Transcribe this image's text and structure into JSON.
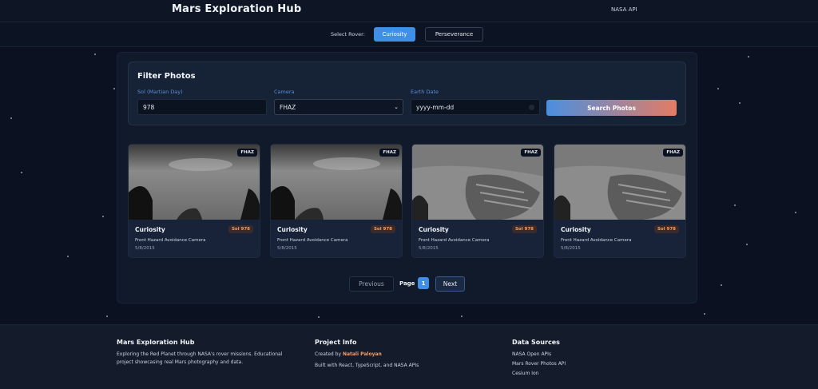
{
  "header": {
    "title": "Mars Exploration Hub",
    "nasa_link": "NASA API"
  },
  "rover_select": {
    "label": "Select Rover:",
    "options": [
      "Curiosity",
      "Perseverance"
    ],
    "selected": "Curiosity"
  },
  "filters": {
    "title": "Filter Photos",
    "sol_label": "Sol (Martian Day)",
    "sol_value": "978",
    "camera_label": "Camera",
    "camera_value": "FHAZ",
    "date_label": "Earth Date",
    "date_placeholder": "yyyy-mm-dd",
    "search_label": "Search Photos"
  },
  "photos": [
    {
      "camera_badge": "FHAZ",
      "rover": "Curiosity",
      "sol": "Sol 978",
      "camera_name": "Front Hazard Avoidance Camera",
      "date": "5/8/2015"
    },
    {
      "camera_badge": "FHAZ",
      "rover": "Curiosity",
      "sol": "Sol 978",
      "camera_name": "Front Hazard Avoidance Camera",
      "date": "5/8/2015"
    },
    {
      "camera_badge": "FHAZ",
      "rover": "Curiosity",
      "sol": "Sol 978",
      "camera_name": "Front Hazard Avoidance Camera",
      "date": "5/8/2015"
    },
    {
      "camera_badge": "FHAZ",
      "rover": "Curiosity",
      "sol": "Sol 978",
      "camera_name": "Front Hazard Avoidance Camera",
      "date": "5/8/2015"
    }
  ],
  "pagination": {
    "previous": "Previous",
    "page_label": "Page",
    "page_number": "1",
    "next": "Next"
  },
  "footer": {
    "col1_title": "Mars Exploration Hub",
    "col1_text": "Exploring the Red Planet through NASA's rover missions. Educational project showcasing real Mars photography and data.",
    "col2_title": "Project Info",
    "col2_created": "Created by",
    "col2_author": "Natali Paloyan",
    "col2_built": "Built with React, TypeScript, and NASA APIs",
    "col3_title": "Data Sources",
    "col3_links": [
      "NASA Open APIs",
      "Mars Rover Photos API",
      "Cesium Ion"
    ]
  },
  "colors": {
    "accent_blue": "#3f8fe6",
    "accent_orange": "#f59e63",
    "background": "#0b1120"
  }
}
